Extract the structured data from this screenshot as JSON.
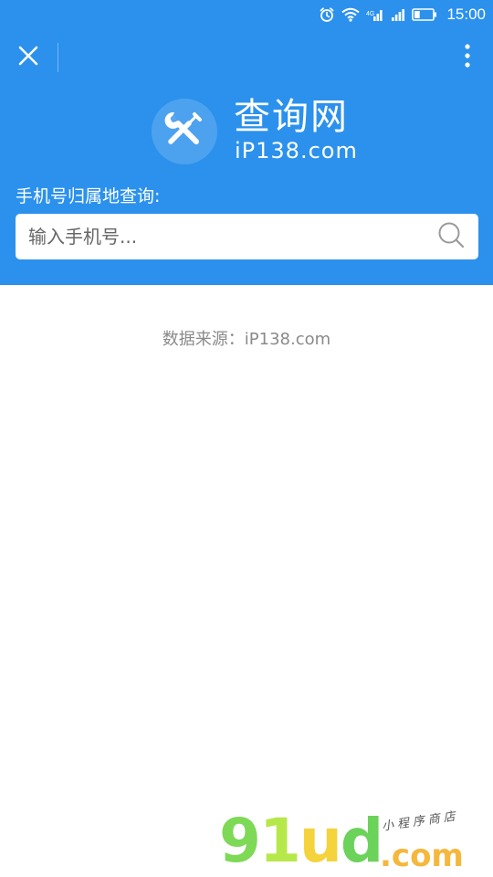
{
  "status_bar": {
    "time": "15:00",
    "icons": [
      "alarm-icon",
      "wifi-icon",
      "signal-icon",
      "signal-icon",
      "battery-icon"
    ],
    "battery_level": 0.3
  },
  "nav": {
    "close_icon": "close-icon",
    "more_icon": "more-vertical-icon"
  },
  "brand": {
    "logo_icon": "tools-icon",
    "name": "查询网",
    "domain": "iP138.com"
  },
  "search": {
    "label": "手机号归属地查询:",
    "placeholder": "输入手机号...",
    "value": "",
    "button_icon": "search-icon"
  },
  "footer": {
    "source": "数据来源：iP138.com"
  },
  "watermark": {
    "main_chars": [
      "9",
      "1",
      "u",
      "d"
    ],
    "domain_suffix": ".com",
    "tagline": "小程序商店"
  },
  "colors": {
    "header_bg": "#2b91ec",
    "page_bg": "#ffffff",
    "search_box_bg": "#ffffff",
    "source_text": "#8a8a8a"
  }
}
